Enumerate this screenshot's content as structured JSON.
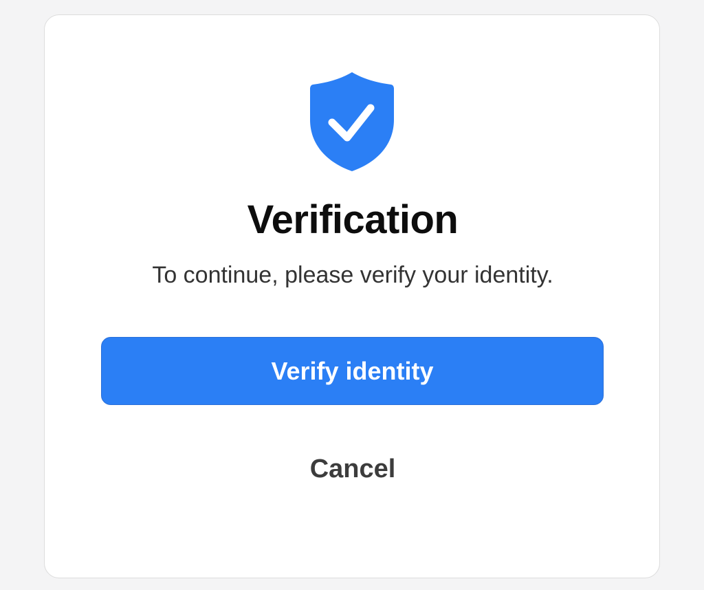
{
  "dialog": {
    "icon": "shield-check-icon",
    "title": "Verification",
    "message": "To continue, please verify your identity.",
    "primary_button_label": "Verify identity",
    "cancel_button_label": "Cancel"
  },
  "colors": {
    "accent": "#2b7ff5",
    "background": "#f4f4f5",
    "card": "#ffffff",
    "title_text": "#0d0d0d",
    "body_text": "#333333"
  }
}
